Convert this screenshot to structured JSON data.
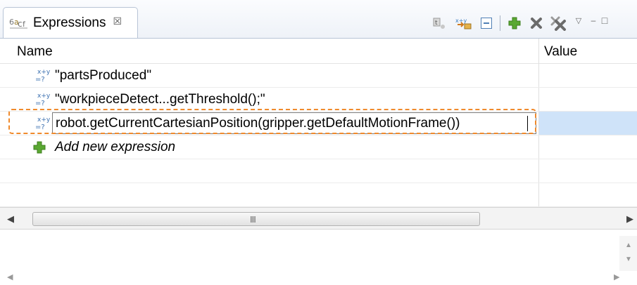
{
  "view": {
    "tab_title": "Expressions",
    "tab_close_glyph": "☒",
    "tab_icon": "expressions-icon"
  },
  "toolbar": {
    "icons": [
      "show-type-names-icon",
      "create-watch-icon",
      "collapse-all-icon",
      "add-expression-icon",
      "remove-expression-icon",
      "remove-all-expressions-icon",
      "view-menu-icon",
      "minimize-icon",
      "maximize-icon"
    ],
    "view_menu_glyph": "▽",
    "minimize_glyph": "–",
    "maximize_glyph": "□"
  },
  "table": {
    "columns": [
      "Name",
      "Value"
    ],
    "rows": [
      {
        "name": "\"partsProduced\"",
        "value": ""
      },
      {
        "name": "\"workpieceDetect...getThreshold();\"",
        "value": ""
      },
      {
        "name": "robot.getCurrentCartesianPosition(gripper.getDefaultMotionFrame())",
        "value": "",
        "editing": true
      }
    ],
    "add_label": "Add new expression"
  },
  "scrollbar": {
    "left_arrow": "◀",
    "right_arrow": "▶",
    "grip": "III"
  },
  "details": {
    "up_arrow": "▲",
    "down_arrow": "▼",
    "left_arrow": "◀",
    "right_arrow": "▶"
  },
  "colors": {
    "selection": "#cfe3f9",
    "highlight": "#f08a2c",
    "add_green": "#5aa832",
    "remove_gray": "#6b6b6b"
  }
}
